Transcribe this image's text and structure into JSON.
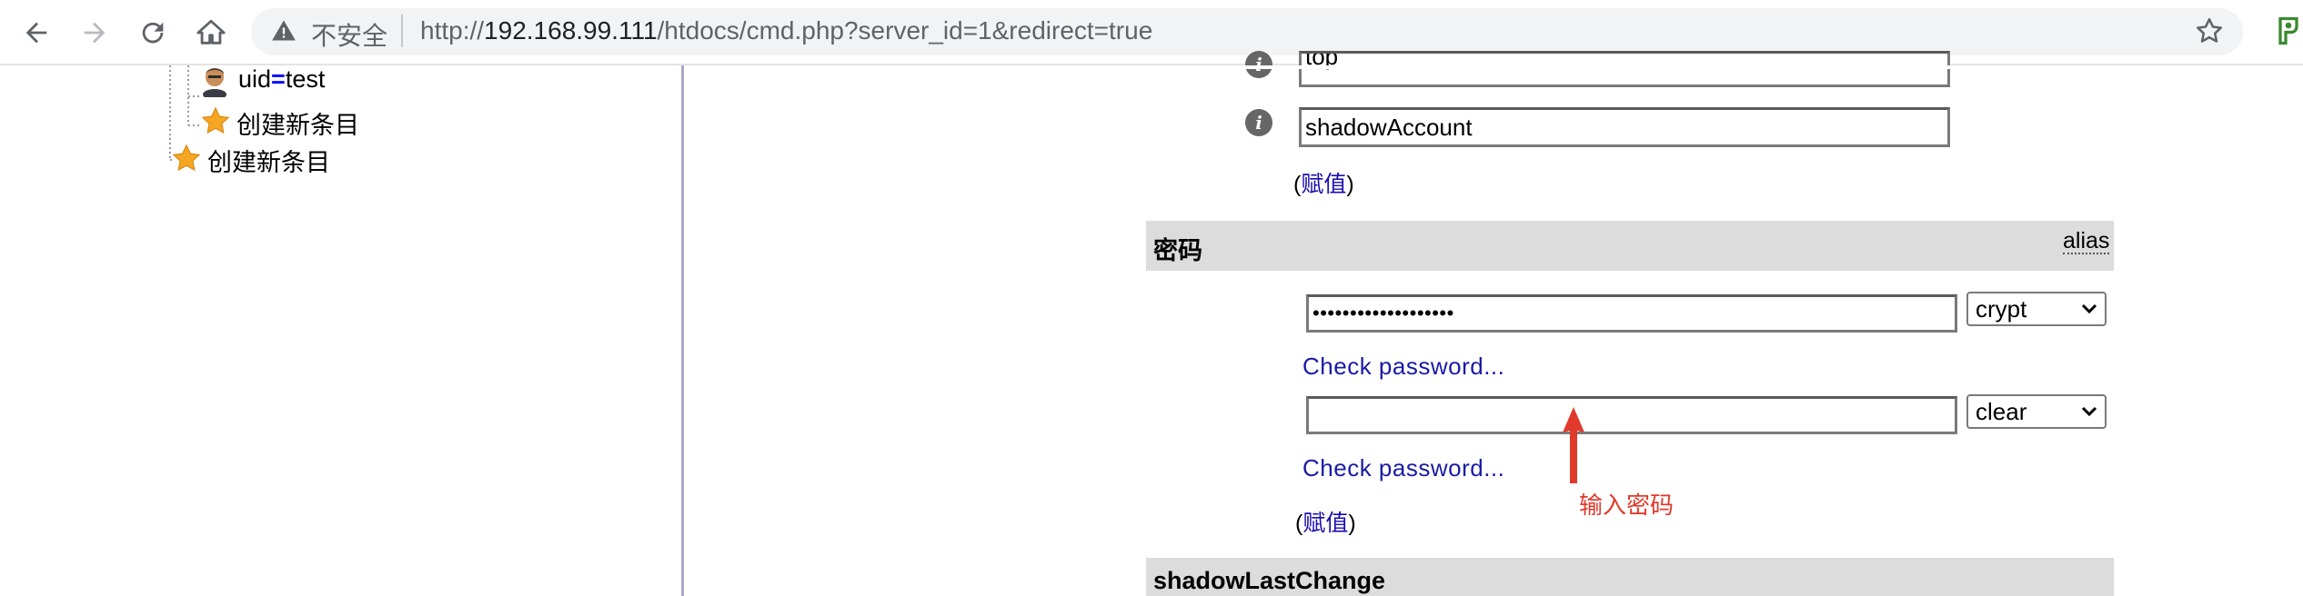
{
  "browser": {
    "security_label": "不安全",
    "url_prefix": "http://",
    "url_host": "192.168.99.111",
    "url_path": "/htdocs/cmd.php?server_id=1&redirect=true"
  },
  "tree": {
    "entry_attr": "uid",
    "entry_eq": "=",
    "entry_value": "test",
    "create_child_label": "创建新条目",
    "create_sibling_label": "创建新条目"
  },
  "form": {
    "objectclass_values": [
      "top",
      "shadowAccount"
    ],
    "assign_link_1": "赋值",
    "password_section_title": "密码",
    "password_alias": "alias",
    "password_value": "•••••••••••••••••••",
    "password_hash_1": "crypt",
    "check_password_1": "Check password...",
    "password_confirm_value": "",
    "password_hash_2": "clear",
    "check_password_2": "Check password...",
    "assign_link_2": "赋值",
    "next_section_title": "shadowLastChange",
    "paren_open": "(",
    "paren_close": ")"
  },
  "annotation": {
    "text": "输入密码",
    "color": "#e03a2c"
  }
}
